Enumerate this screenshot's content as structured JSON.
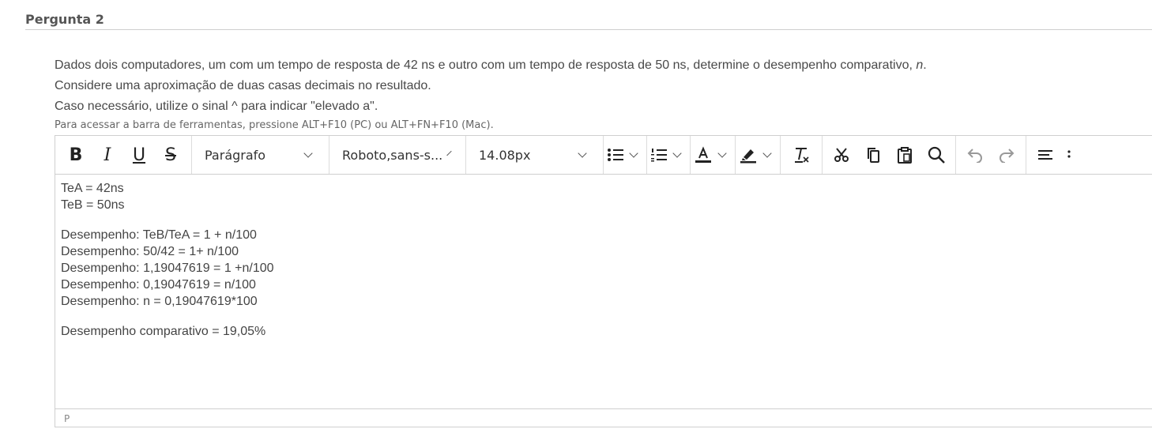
{
  "question": {
    "title": "Pergunta 2",
    "line1_pre": "Dados dois computadores, um com um tempo de resposta de 42 ns e outro com um tempo de resposta de 50 ns, determine o desempenho comparativo, ",
    "line1_var": "n",
    "line1_post": ".",
    "line2": "Considere uma aproximação de duas casas decimais no resultado.",
    "line3": "Caso necessário, utilize o sinal ^ para indicar \"elevado a\"."
  },
  "hint": "Para acessar a barra de ferramentas, pressione ALT+F10 (PC) ou ALT+FN+F10 (Mac).",
  "toolbar": {
    "bold": "B",
    "italic": "I",
    "underline": "U",
    "strike": "S",
    "block_format": "Parágrafo",
    "font_family": "Roboto,sans-s...",
    "font_size": "14.08px"
  },
  "content": {
    "p1": [
      "TeA = 42ns",
      "TeB = 50ns"
    ],
    "p2": [
      "Desempenho: TeB/TeA = 1 + n/100",
      "Desempenho: 50/42 = 1+ n/100",
      "Desempenho: 1,19047619 = 1 +n/100",
      "Desempenho: 0,19047619 = n/100",
      "Desempenho: n = 0,19047619*100"
    ],
    "p3": [
      "Desempenho comparativo = 19,05%"
    ]
  },
  "statusbar": {
    "path": "P"
  }
}
